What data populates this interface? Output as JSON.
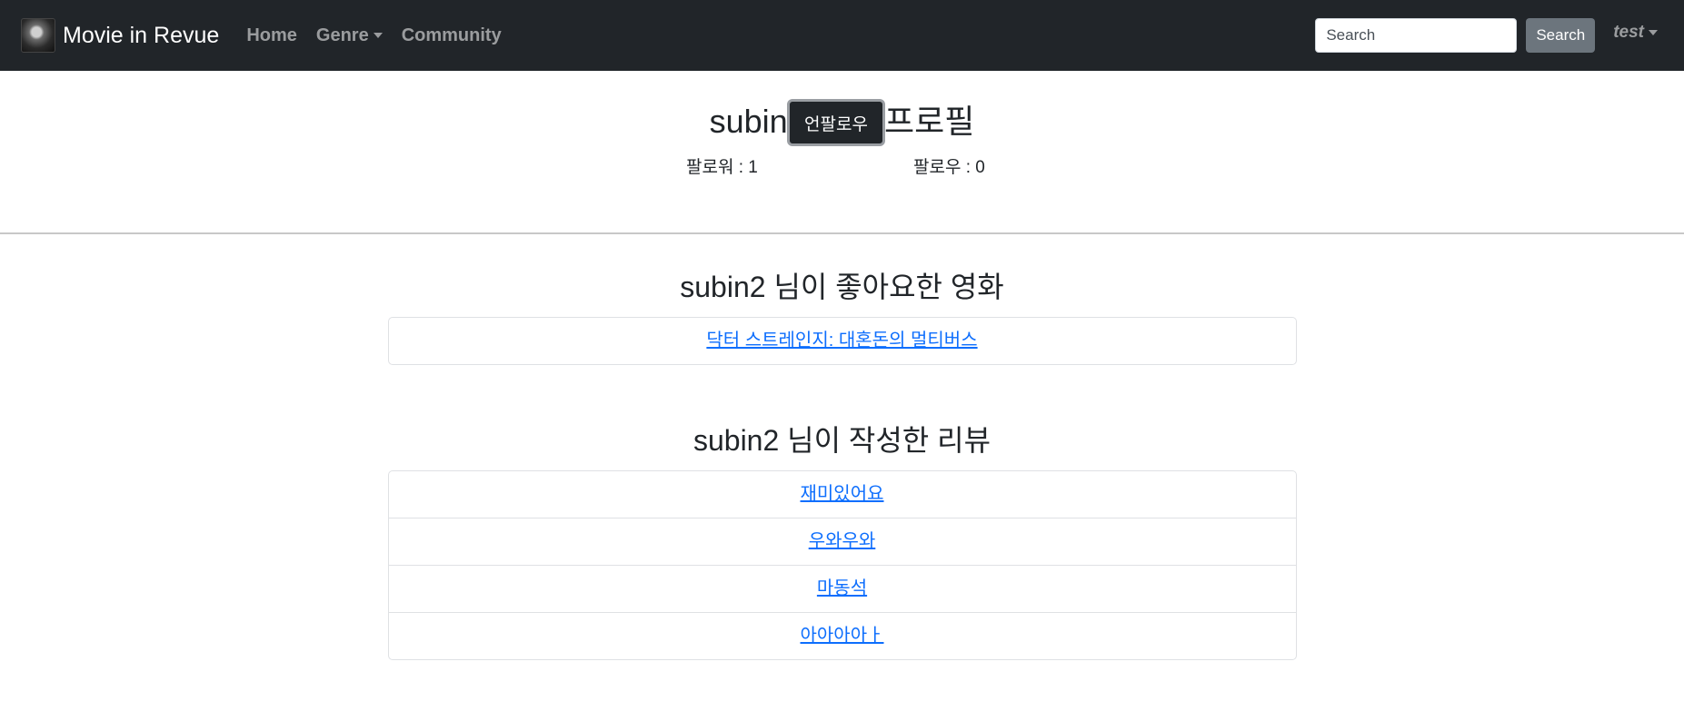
{
  "navbar": {
    "brand": "Movie in Revue",
    "links": {
      "home": "Home",
      "genre": "Genre",
      "community": "Community"
    },
    "search": {
      "placeholder": "Search",
      "button_label": "Search"
    },
    "user": "test"
  },
  "profile": {
    "title": "subin2 님의 프로필",
    "followers_text": "팔로워 : 1",
    "following_text": "팔로우 : 0",
    "unfollow_label": "언팔로우"
  },
  "liked_movies": {
    "title": "subin2 님이 좋아요한 영화",
    "items": [
      "닥터 스트레인지: 대혼돈의 멀티버스"
    ]
  },
  "reviews": {
    "title": "subin2 님이 작성한 리뷰",
    "items": [
      "재미있어요",
      "우와우와",
      "마동석",
      "아아아아ㅏ"
    ]
  },
  "colors": {
    "navbar_bg": "#212529",
    "link": "#0d6efd",
    "search_button": "#6c757d"
  }
}
